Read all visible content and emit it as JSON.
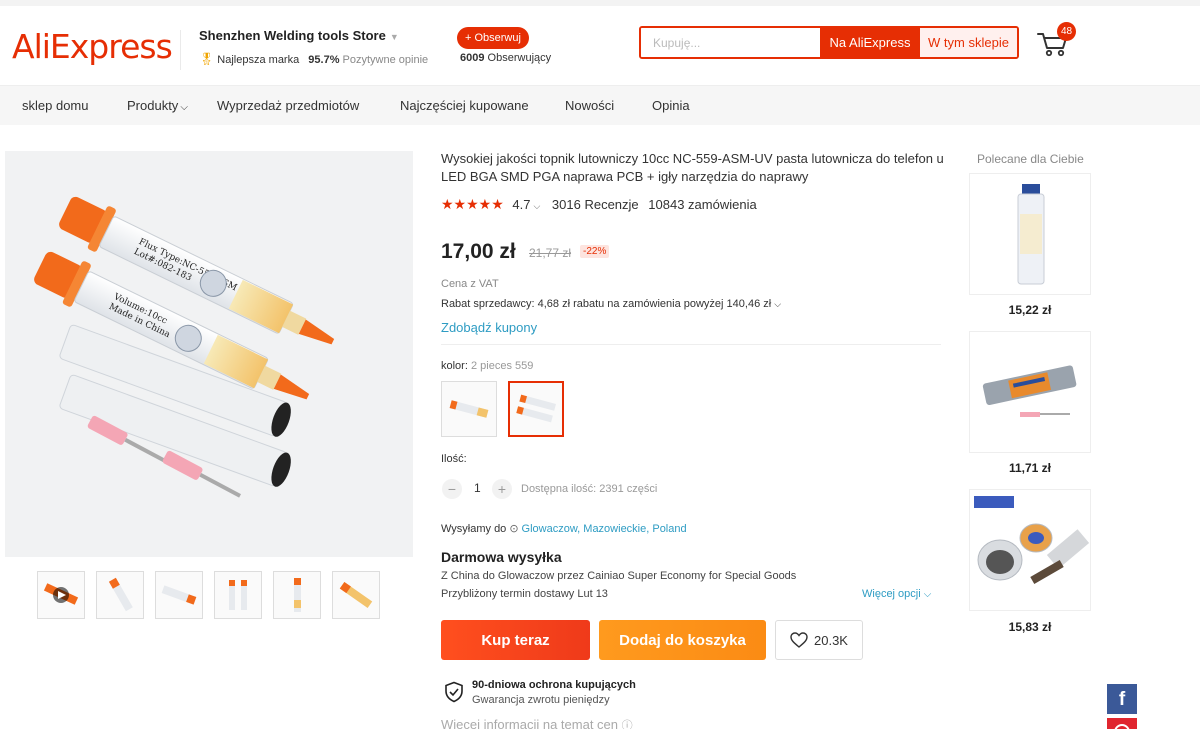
{
  "header": {
    "logo": "AliExpress",
    "store_name": "Shenzhen Welding tools Store",
    "badge_label": "Najlepsza marka",
    "positive_percent": "95.7%",
    "positive_label": "Pozytywne opinie",
    "follow_label": "+ Obserwuj",
    "followers_count": "6009",
    "followers_label": "Obserwujący",
    "search_placeholder": "Kupuję...",
    "search_aliexpress": "Na AliExpress",
    "search_store": "W tym sklepie",
    "cart_count": "48"
  },
  "nav": {
    "items": [
      "sklep domu",
      "Produkty",
      "Wyprzedaż przedmiotów",
      "Najczęściej kupowane",
      "Nowości",
      "Opinia"
    ]
  },
  "product": {
    "title": "Wysokiej jakości topnik lutowniczy 10cc NC-559-ASM-UV pasta lutownicza do telefon u LED BGA SMD PGA naprawa PCB + igły narzędzia do naprawy",
    "rating": "4.7",
    "reviews": "3016 Recenzje",
    "orders": "10843 zamówienia",
    "price": "17,00 zł",
    "old_price": "21,77 zł",
    "discount": "-22%",
    "vat_note": "Cena z VAT",
    "rebate": "Rabat sprzedawcy: 4,68 zł rabatu na zamówienia powyżej 140,46 zł",
    "coupons": "Zdobądź kupony",
    "color_label": "kolor:",
    "color_value": "2 pieces 559",
    "quantity_label": "Ilość:",
    "quantity": "1",
    "available": "Dostępna ilość: 2391 części",
    "image_labels": {
      "line1": "Flux Type:NC-559-ASM",
      "line2": "Lot#:082-183",
      "line3": "Volume:10cc",
      "line4": "Made in China"
    }
  },
  "shipping": {
    "ship_to_label": "Wysyłamy do",
    "location": "Glowaczow, Mazowieckie, Poland",
    "free": "Darmowa wysyłka",
    "route_from": "Z",
    "route_origin": "China",
    "route_to": "do",
    "route_dest": "Glowaczow",
    "route_via": "przez Cainiao Super Economy for Special Goods",
    "estimate_label": "Przybliżony termin dostawy",
    "estimate_date": "Lut 13",
    "more_options": "Więcej opcji"
  },
  "actions": {
    "buy": "Kup teraz",
    "add_to_cart": "Dodaj do koszyka",
    "wishlist_count": "20.3K"
  },
  "protection": {
    "title": "90-dniowa ochrona kupujących",
    "subtitle": "Gwarancja zwrotu pieniędzy",
    "more_info": "Więcej informacji na temat cen"
  },
  "recommended": {
    "title": "Polecane dla Ciebie",
    "prices": [
      "15,22 zł",
      "11,71 zł",
      "15,83 zł"
    ]
  },
  "social": {
    "facebook": "f"
  },
  "colors": {
    "accent": "#e62e04",
    "buy_button": "#ff4f1e",
    "cart_button": "#fb8b14",
    "link": "#2e9cc3"
  }
}
